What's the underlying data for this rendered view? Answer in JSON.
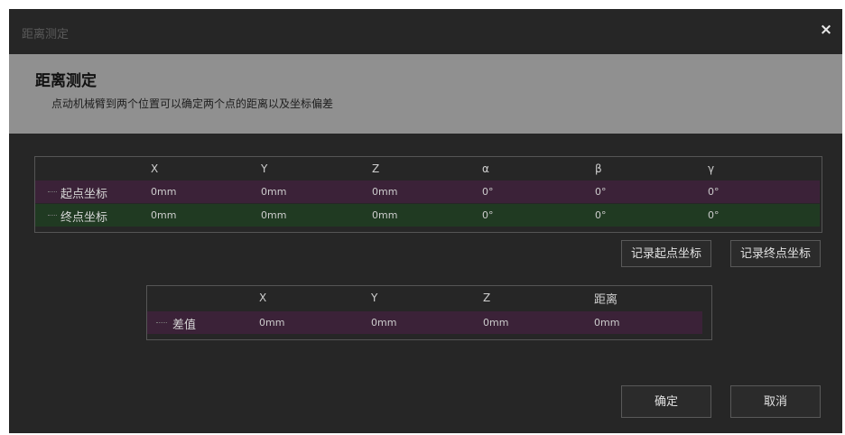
{
  "window": {
    "title": "距离测定",
    "close_icon": "×"
  },
  "header": {
    "title": "距离测定",
    "description": "点动机械臂到两个位置可以确定两个点的距离以及坐标偏差"
  },
  "coord_table": {
    "columns": [
      "X",
      "Y",
      "Z",
      "α",
      "β",
      "γ"
    ],
    "rows": [
      {
        "label": "起点坐标",
        "values": [
          "0mm",
          "0mm",
          "0mm",
          "0°",
          "0°",
          "0°"
        ]
      },
      {
        "label": "终点坐标",
        "values": [
          "0mm",
          "0mm",
          "0mm",
          "0°",
          "0°",
          "0°"
        ]
      }
    ]
  },
  "record_buttons": {
    "start": "记录起点坐标",
    "end": "记录终点坐标"
  },
  "diff_table": {
    "columns": [
      "X",
      "Y",
      "Z",
      "距离"
    ],
    "row": {
      "label": "差值",
      "values": [
        "0mm",
        "0mm",
        "0mm",
        "0mm"
      ]
    }
  },
  "footer": {
    "confirm": "确定",
    "cancel": "取消"
  },
  "colors": {
    "start_row": "#3b2238",
    "end_row": "#203a22",
    "header_bg": "#909090",
    "dialog_bg": "#262626"
  }
}
